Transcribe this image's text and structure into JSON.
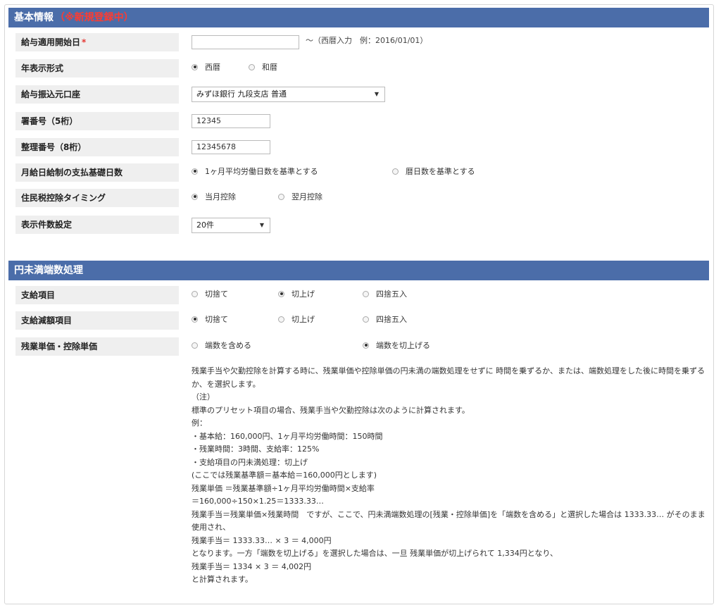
{
  "section1": {
    "title": "基本情報",
    "note": "（※新規登録中）"
  },
  "fields": {
    "start_date": {
      "label": "給与適用開始日",
      "required_mark": "*",
      "value": "",
      "hint": "～（西暦入力　例：2016/01/01）"
    },
    "year_format": {
      "label": "年表示形式",
      "options": [
        "西暦",
        "和暦"
      ],
      "selected": 0
    },
    "bank_account": {
      "label": "給与振込元口座",
      "value": "みずほ銀行 九段支店 普通"
    },
    "office_no": {
      "label": "署番号（5桁）",
      "value": "12345"
    },
    "ref_no": {
      "label": "整理番号（8桁）",
      "value": "12345678"
    },
    "base_days": {
      "label": "月給日給制の支払基礎日数",
      "options": [
        "1ヶ月平均労働日数を基準とする",
        "暦日数を基準とする"
      ],
      "selected": 0
    },
    "resident_tax": {
      "label": "住民税控除タイミング",
      "options": [
        "当月控除",
        "翌月控除"
      ],
      "selected": 0
    },
    "page_size": {
      "label": "表示件数設定",
      "value": "20件"
    }
  },
  "section2": {
    "title": "円未満端数処理"
  },
  "rounding": {
    "payment": {
      "label": "支給項目",
      "options": [
        "切捨て",
        "切上げ",
        "四捨五入"
      ],
      "selected": 1
    },
    "deduction": {
      "label": "支給減額項目",
      "options": [
        "切捨て",
        "切上げ",
        "四捨五入"
      ],
      "selected": 0
    },
    "overtime": {
      "label": "残業単価・控除単価",
      "options": [
        "端数を含める",
        "端数を切上げる"
      ],
      "selected": 1
    }
  },
  "description": [
    "残業手当や欠勤控除を計算する時に、残業単価や控除単価の円未満の端数処理をせずに 時間を乗ずるか、または、端数処理をした後に時間を乗ずるか、を選択します。",
    "（注）",
    "標準のプリセット項目の場合、残業手当や欠勤控除は次のように計算されます。",
    "例：",
    "・基本給：160,000円、1ヶ月平均労働時間：150時間",
    "・残業時間：3時間、支給率：125%",
    "・支給項目の円未満処理：切上げ",
    "(ここでは残業基準額＝基本給＝160,000円とします)",
    "残業単価 ＝残業基準額÷1ヶ月平均労働時間×支給率",
    "＝160,000÷150×1.25＝1333.33…",
    "残業手当＝残業単価×残業時間　ですが、ここで、円未満端数処理の[残業・控除単価]を「端数を含める」と選択した場合は 1333.33… がそのまま使用され、",
    "残業手当＝ 1333.33… × 3 ＝ 4,000円",
    "となります。一方「端数を切上げる」を選択した場合は、一旦 残業単価が切上げられて 1,334円となり、",
    "残業手当＝ 1334 × 3 ＝ 4,002円",
    "と計算されます。"
  ]
}
